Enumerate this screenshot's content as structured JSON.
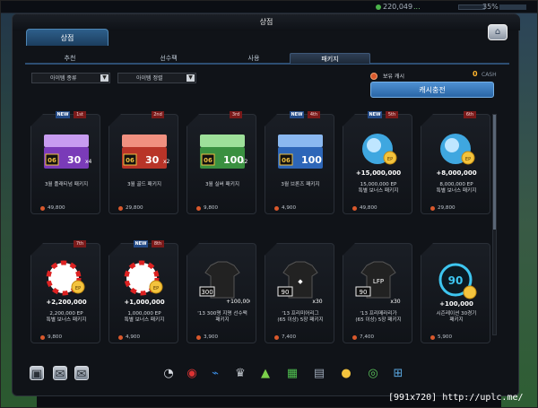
{
  "top": {
    "ep": "220,049",
    "user": "...",
    "percent": "35%"
  },
  "window": {
    "title": "상점"
  },
  "shop_tab": "상점",
  "tabs": [
    {
      "label": "추천",
      "active": false
    },
    {
      "label": "선수팩",
      "active": false
    },
    {
      "label": "사용",
      "active": false
    },
    {
      "label": "패키지",
      "active": true
    }
  ],
  "filters": {
    "type": "아이템 종류",
    "sort": "아이템 정렬"
  },
  "cash": {
    "label": "보유 캐시",
    "value": "0",
    "unit": "CASH",
    "charge_button": "캐시충전"
  },
  "products": [
    {
      "name": "3월 플래티넘 패키지",
      "price": "49,800",
      "new": "NEW",
      "rank": "1st",
      "art": "box-purple",
      "art_text": "30",
      "art_mult": "x4",
      "art_tag": "06"
    },
    {
      "name": "3월 골드 패키지",
      "price": "29,800",
      "new": "",
      "rank": "2nd",
      "art": "box-red",
      "art_text": "30",
      "art_mult": "x2",
      "art_tag": "06"
    },
    {
      "name": "3월 실버 패키지",
      "price": "9,800",
      "new": "",
      "rank": "3rd",
      "art": "box-green",
      "art_text": "100",
      "art_mult": "x2",
      "art_tag": "06"
    },
    {
      "name": "3월 브론즈 패키지",
      "price": "4,900",
      "new": "NEW",
      "rank": "4th",
      "art": "box-blue",
      "art_text": "100",
      "art_mult": "",
      "art_tag": "06"
    },
    {
      "name": "15,000,000 EP\n특별 보너스 패키지",
      "price": "49,800",
      "new": "NEW",
      "rank": "5th",
      "art": "orb-blue",
      "art_text": "+15,000,000",
      "art_mult": "",
      "art_tag": "EP"
    },
    {
      "name": "8,000,000 EP\n특별 보너스 패키지",
      "price": "29,800",
      "new": "",
      "rank": "6th",
      "art": "orb-blue",
      "art_text": "+8,000,000",
      "art_mult": "",
      "art_tag": "EP"
    },
    {
      "name": "2,200,000 EP\n특별 보너스 패키지",
      "price": "9,800",
      "new": "",
      "rank": "7th",
      "art": "ball-red",
      "art_text": "+2,200,000",
      "art_mult": "",
      "art_tag": "EP"
    },
    {
      "name": "1,000,000 EP\n특별 보너스 패키지",
      "price": "4,900",
      "new": "NEW",
      "rank": "8th",
      "art": "ball-red",
      "art_text": "+1,000,000",
      "art_mult": "",
      "art_tag": "EP"
    },
    {
      "name": "'13 300명 지명 선수팩\n패키지",
      "price": "3,900",
      "new": "",
      "rank": "",
      "art": "jersey-black",
      "art_text": "+100,000",
      "art_mult": "",
      "art_tag": "300"
    },
    {
      "name": "'13 프리미어리그\n(65 이상) 5장 패키지",
      "price": "7,400",
      "new": "",
      "rank": "",
      "art": "jersey-pl",
      "art_text": "x30",
      "art_mult": "",
      "art_tag": "90"
    },
    {
      "name": "'13 프리메라리가\n(65 이상) 5장 패키지",
      "price": "7,400",
      "new": "",
      "rank": "",
      "art": "jersey-lfp",
      "art_text": "x30",
      "art_mult": "",
      "art_tag": "90"
    },
    {
      "name": "시즌레이션 30경기\n패키지",
      "price": "5,900",
      "new": "",
      "rank": "",
      "art": "disc-90",
      "art_text": "+100,000",
      "art_mult": "",
      "art_tag": "90"
    }
  ],
  "bottom_icons": [
    "player-card-icon",
    "chat-icon",
    "mail-icon",
    "whistle-icon",
    "ball-icon",
    "boot-icon",
    "trophy-icon",
    "cone-icon",
    "pitch-icon",
    "book-icon",
    "coin-ep-icon",
    "club-icon",
    "cart-icon"
  ],
  "watermark": "[991x720] http://uplc.me/",
  "colors": {
    "accent": "#2b66a6",
    "cash": "#ffb52e",
    "rank": "#7a1a1a",
    "new": "#234a86"
  }
}
